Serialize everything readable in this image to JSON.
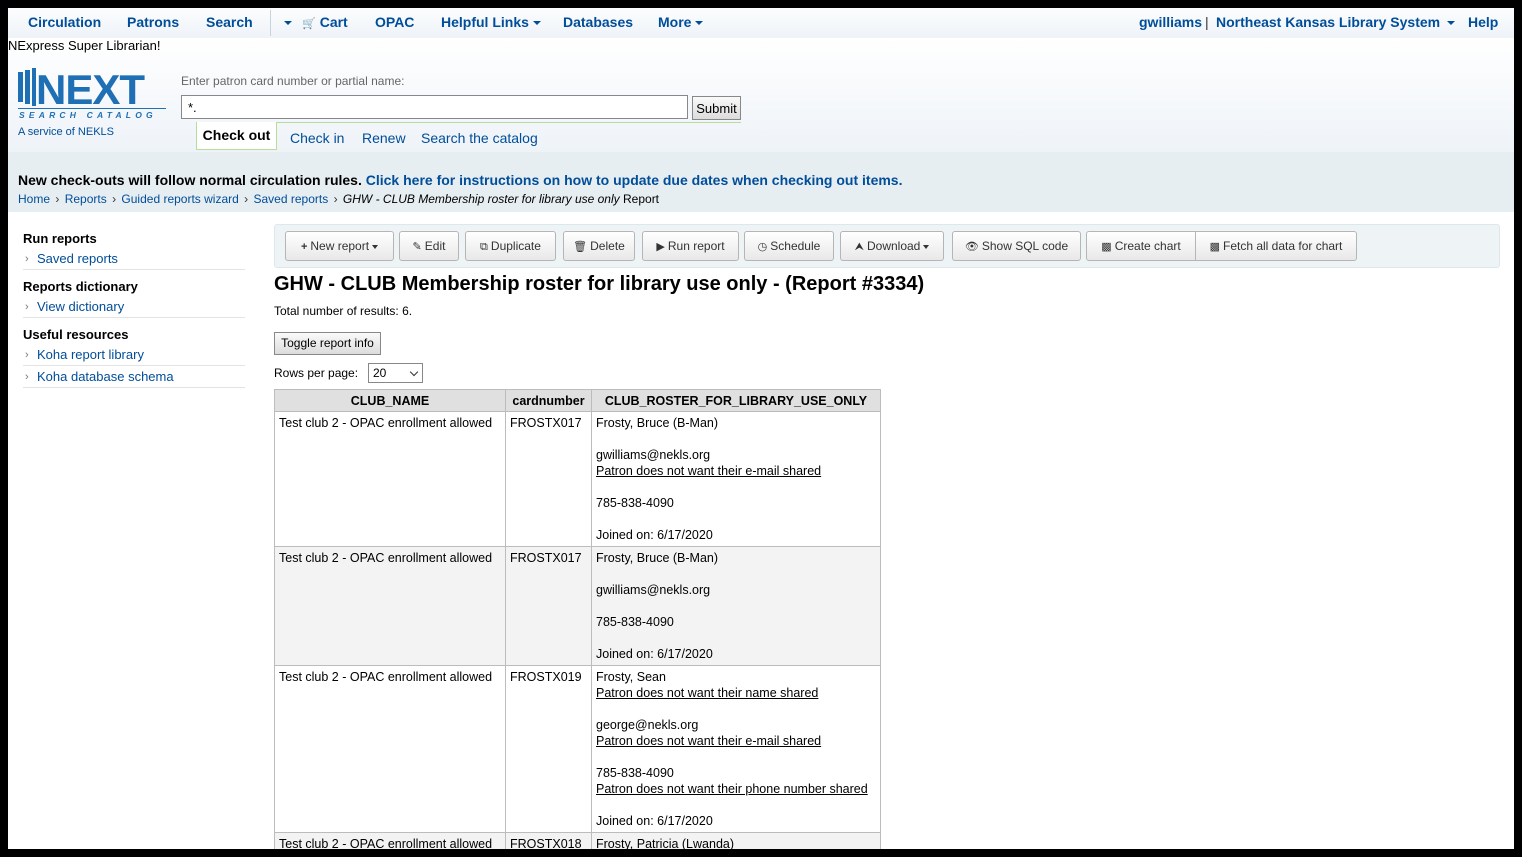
{
  "topnav": {
    "circulation": "Circulation",
    "patrons": "Patrons",
    "search": "Search",
    "cart": "Cart",
    "opac": "OPAC",
    "helpful_links": "Helpful Links",
    "databases": "Databases",
    "more": "More",
    "user": "gwilliams",
    "user_sep": "|",
    "library": "Northeast Kansas Library System",
    "help": "Help"
  },
  "header": {
    "library_name": "NExpress Super Librarian!",
    "logo_text": "NEXT",
    "logo_subtext": "SEARCH CATALOG",
    "logo_tagline": "A service of NEKLS",
    "patron_label": "Enter patron card number or partial name:",
    "patron_value": "*.",
    "submit_label": "Submit",
    "tabs": {
      "checkout": "Check out",
      "checkin": "Check in",
      "renew": "Renew",
      "search_catalog": "Search the catalog"
    }
  },
  "notice": {
    "text": "New check-outs will follow normal circulation rules.",
    "link": "Click here for instructions on how to update due dates when checking out items."
  },
  "breadcrumb": {
    "home": "Home",
    "reports": "Reports",
    "wizard": "Guided reports wizard",
    "saved": "Saved reports",
    "current": "GHW - CLUB Membership roster for library use only",
    "suffix": "Report",
    "sep": "›"
  },
  "sidebar": {
    "run_reports": "Run reports",
    "saved_reports": "Saved reports",
    "reports_dictionary": "Reports dictionary",
    "view_dictionary": "View dictionary",
    "useful_resources": "Useful resources",
    "koha_report_library": "Koha report library",
    "koha_database_schema": "Koha database schema",
    "bullet": "›"
  },
  "toolbar": {
    "new_report": "New report",
    "edit": "Edit",
    "duplicate": "Duplicate",
    "delete": "Delete",
    "run_report": "Run report",
    "schedule": "Schedule",
    "download": "Download",
    "show_sql": "Show SQL code",
    "create_chart": "Create chart",
    "fetch_all": "Fetch all data for chart"
  },
  "report": {
    "title": "GHW - CLUB Membership roster for library use only - (Report #3334)",
    "total_label": "Total number of results:",
    "total_value": "6.",
    "toggle_label": "Toggle report info",
    "rows_label": "Rows per page:",
    "rows_value": "20"
  },
  "table": {
    "headers": [
      "CLUB_NAME",
      "cardnumber",
      "CLUB_ROSTER_FOR_LIBRARY_USE_ONLY"
    ],
    "rows": [
      {
        "club": "Test club 2 - OPAC enrollment allowed",
        "card": "FROSTX017",
        "name": "Frosty, Bruce (B-Man)",
        "email": "gwilliams@nekls.org",
        "email_note": "Patron does not want their e-mail shared",
        "phone": "785-838-4090",
        "joined": "Joined on: 6/17/2020"
      },
      {
        "club": "Test club 2 - OPAC enrollment allowed",
        "card": "FROSTX017",
        "name": "Frosty, Bruce (B-Man)",
        "email": "gwilliams@nekls.org",
        "phone": "785-838-4090",
        "joined": "Joined on: 6/17/2020"
      },
      {
        "club": "Test club 2 - OPAC enrollment allowed",
        "card": "FROSTX019",
        "name": "Frosty, Sean",
        "name_note": "Patron does not want their name shared",
        "email": "george@nekls.org",
        "email_note": "Patron does not want their e-mail shared",
        "phone": "785-838-4090",
        "phone_note": "Patron does not want their phone number shared",
        "joined": "Joined on: 6/17/2020"
      },
      {
        "club": "Test club 2 - OPAC enrollment allowed",
        "card": "FROSTX018",
        "name": "Frosty, Patricia (Lwanda)"
      }
    ]
  },
  "colors": {
    "link": "#004d99",
    "notice_band": "#e6eef2",
    "toolbar_bg": "#eef4f6",
    "active_tab_border": "#b9dc9a"
  }
}
